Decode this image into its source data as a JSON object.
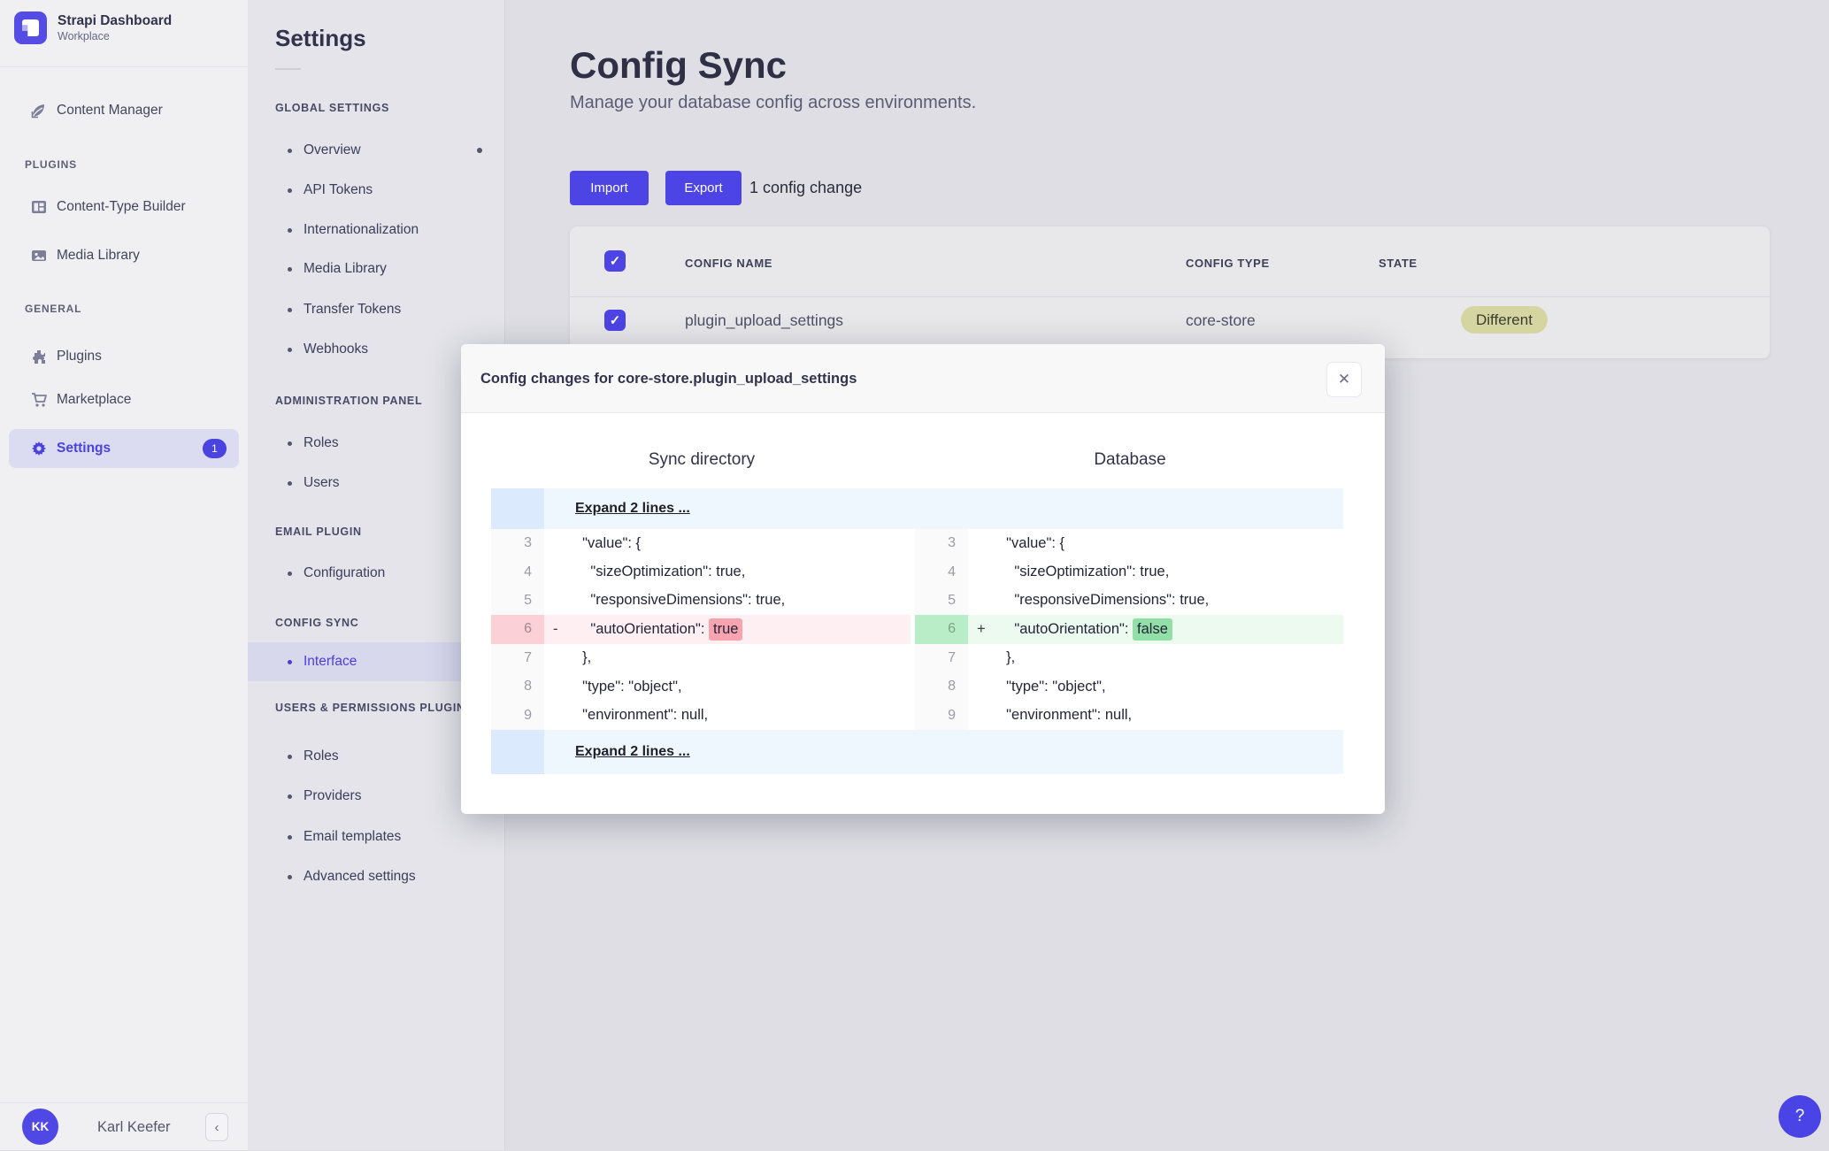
{
  "colors": {
    "accent": "#4a43e2",
    "badge_different_bg": "#d5d5a1",
    "diff_removed_bg": "#fdeff2",
    "diff_removed_word": "#f8a4b0",
    "diff_added_bg": "#ecfaef",
    "diff_added_word": "#92e0a7",
    "fold_bg": "#eff7fe"
  },
  "brand": {
    "name": "Strapi Dashboard",
    "workspace": "Workplace"
  },
  "nav": {
    "content_manager": "Content Manager",
    "sections": [
      {
        "title": "PLUGINS",
        "items": [
          {
            "label": "Content-Type Builder"
          },
          {
            "label": "Media Library"
          }
        ]
      },
      {
        "title": "GENERAL",
        "items": [
          {
            "label": "Plugins"
          },
          {
            "label": "Marketplace"
          },
          {
            "label": "Settings",
            "badge": "1"
          }
        ]
      }
    ],
    "user": {
      "initials": "KK",
      "name": "Karl Keefer"
    },
    "collapse_icon": "‹"
  },
  "subnav": {
    "title": "Settings",
    "sections": [
      {
        "title": "GLOBAL SETTINGS",
        "items": [
          {
            "label": "Overview"
          },
          {
            "label": "API Tokens"
          },
          {
            "label": "Internationalization"
          },
          {
            "label": "Media Library"
          },
          {
            "label": "Transfer Tokens"
          },
          {
            "label": "Webhooks"
          }
        ]
      },
      {
        "title": "ADMINISTRATION PANEL",
        "items": [
          {
            "label": "Roles"
          },
          {
            "label": "Users"
          }
        ]
      },
      {
        "title": "EMAIL PLUGIN",
        "items": [
          {
            "label": "Configuration"
          }
        ]
      },
      {
        "title": "CONFIG SYNC",
        "items": [
          {
            "label": "Interface"
          }
        ]
      },
      {
        "title": "USERS & PERMISSIONS PLUGIN",
        "items": [
          {
            "label": "Roles"
          },
          {
            "label": "Providers"
          },
          {
            "label": "Email templates"
          },
          {
            "label": "Advanced settings"
          }
        ]
      }
    ]
  },
  "main": {
    "title": "Config Sync",
    "subtitle": "Manage your database config across environments.",
    "import_label": "Import",
    "export_label": "Export",
    "change_count": "1 config change",
    "check_glyph": "✓",
    "table": {
      "headers": {
        "name": "CONFIG NAME",
        "type": "CONFIG TYPE",
        "state": "STATE"
      },
      "row": {
        "name": "plugin_upload_settings",
        "type": "core-store",
        "state": "Different"
      }
    }
  },
  "modal": {
    "title": "Config changes for core-store.plugin_upload_settings",
    "close_glyph": "✕",
    "left_pane_title": "Sync directory",
    "right_pane_title": "Database",
    "expand_top": "Expand 2 lines ...",
    "expand_bottom": "Expand 2 lines ...",
    "diff": {
      "lines": [
        {
          "num": "3",
          "text": "  \"value\": {"
        },
        {
          "num": "4",
          "text": "    \"sizeOptimization\": true,"
        },
        {
          "num": "5",
          "text": "    \"responsiveDimensions\": true,"
        },
        {
          "num": "6",
          "left_marker": "-",
          "right_marker": "+",
          "code_pre": "    \"autoOrientation\": ",
          "left_word": "true",
          "right_word": "false"
        },
        {
          "num": "7",
          "text": "  },"
        },
        {
          "num": "8",
          "text": "  \"type\": \"object\","
        },
        {
          "num": "9",
          "text": "  \"environment\": null,"
        }
      ]
    }
  },
  "help": {
    "label": "?"
  }
}
